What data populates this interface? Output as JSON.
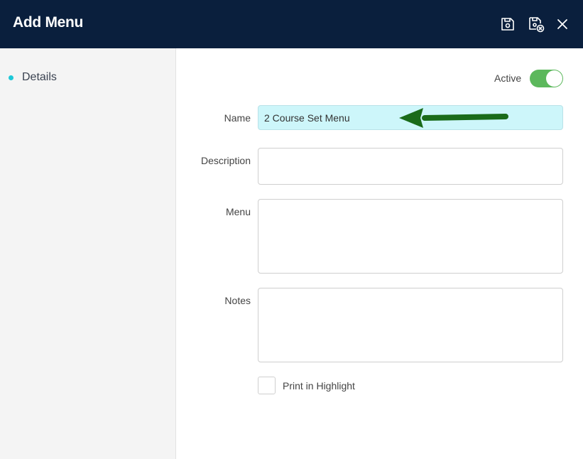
{
  "header": {
    "title": "Add Menu",
    "icons": [
      "save-icon",
      "save-close-icon",
      "close-icon"
    ]
  },
  "sidebar": {
    "items": [
      {
        "label": "Details",
        "dot_color": "#1ec8d8"
      }
    ]
  },
  "form": {
    "active_label": "Active",
    "active_on": true,
    "name_label": "Name",
    "name_value": "2 Course Set Menu",
    "description_label": "Description",
    "description_value": "",
    "menu_label": "Menu",
    "menu_value": "",
    "notes_label": "Notes",
    "notes_value": "",
    "print_highlight_label": "Print in Highlight",
    "print_highlight_checked": false
  },
  "colors": {
    "header_bg": "#0a1f3d",
    "toggle_on": "#5cb85c",
    "highlight_input": "#cdf6fa",
    "arrow": "#1a6b1a"
  }
}
